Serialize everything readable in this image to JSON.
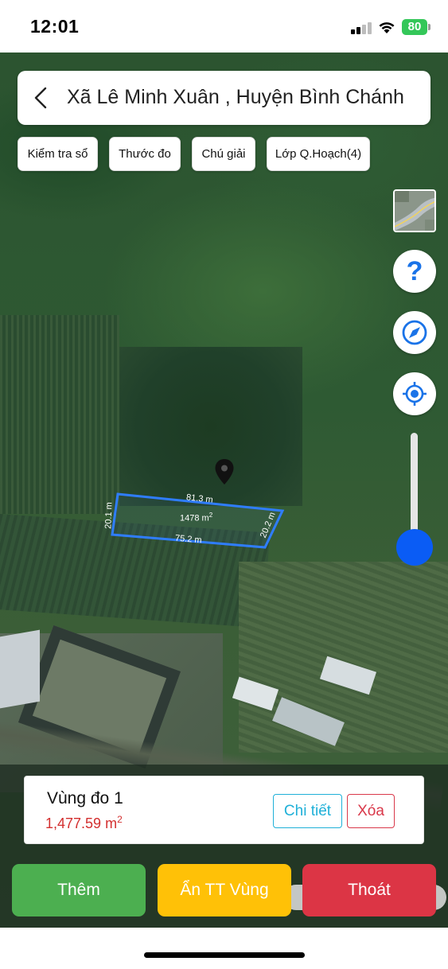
{
  "status_bar": {
    "time": "12:01",
    "battery": "80"
  },
  "header": {
    "title": "Xã Lê Minh Xuân , Huyện Bình Chánh"
  },
  "toolbar": {
    "chips": [
      "Kiểm tra sổ",
      "Thước đo",
      "Chú giải",
      "Lớp Q.Hoạch(4)"
    ]
  },
  "map": {
    "parcel": {
      "area_label": "1478 m",
      "area_sup": "2",
      "top_edge": "81.3 m",
      "bottom_edge": "75.2 m",
      "left_edge": "20.1 m",
      "right_edge": "20.2 m"
    },
    "zoom_level_fraction": 0.9
  },
  "info_card": {
    "area_name": "Vùng đo 1",
    "area_value": "1,477.59 m",
    "area_unit_sup": "2",
    "detail_label": "Chi tiết",
    "delete_label": "Xóa"
  },
  "actions": {
    "add_label": "Thêm",
    "hide_label": "Ẩn TT Vùng",
    "exit_label": "Thoát"
  },
  "colors": {
    "accent_blue": "#0a5cf5",
    "add_green": "#4caf50",
    "hide_yellow": "#ffc107",
    "exit_red": "#dc3545",
    "area_red": "#d32f2f",
    "detail_cyan": "#1fb0d8"
  },
  "icons": {
    "back": "chevron-left-icon",
    "help": "question-icon",
    "compass": "compass-icon",
    "locate": "locate-icon",
    "map_pin": "map-pin-icon",
    "layers": "layer-thumbnail"
  }
}
